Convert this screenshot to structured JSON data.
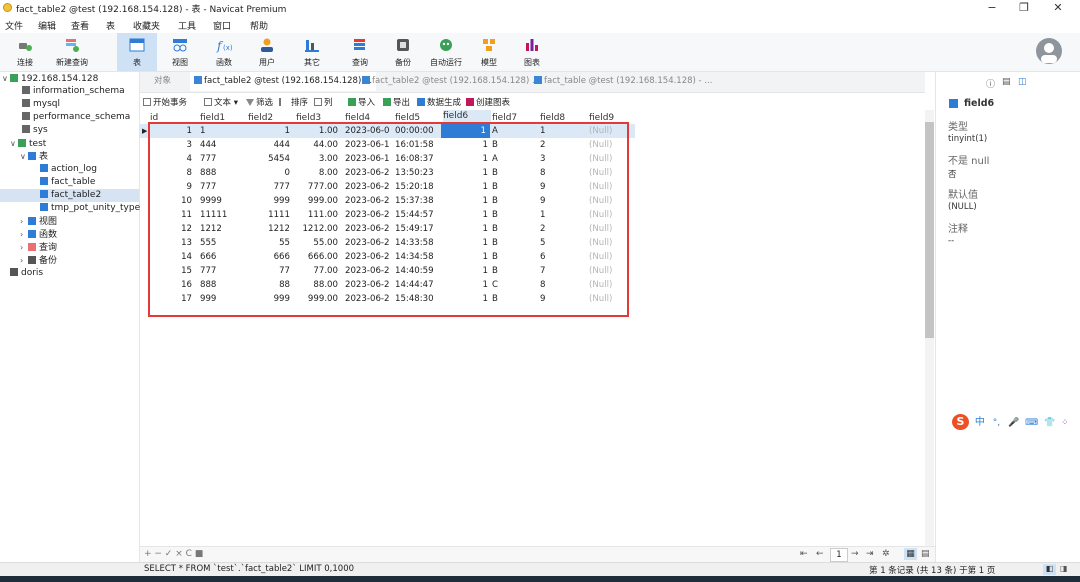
{
  "window": {
    "title": "fact_table2 @test (192.168.154.128) - 表 - Navicat Premium"
  },
  "menu": [
    "文件",
    "编辑",
    "查看",
    "表",
    "收藏夹",
    "工具",
    "窗口",
    "帮助"
  ],
  "toolbar": [
    {
      "label": "连接",
      "icon": "plug-icon",
      "color": "#4caf50"
    },
    {
      "label": "新建查询",
      "icon": "new-query-icon",
      "color": "#4caf50"
    },
    {
      "label": "表",
      "icon": "table-icon",
      "color": "#2e7cd6"
    },
    {
      "label": "视图",
      "icon": "view-icon",
      "color": "#2e7cd6"
    },
    {
      "label": "函数",
      "icon": "function-icon",
      "color": "#2e7cd6"
    },
    {
      "label": "用户",
      "icon": "user-icon",
      "color": "#f0a020"
    },
    {
      "label": "其它",
      "icon": "tools-icon",
      "color": "#2e7cd6"
    },
    {
      "label": "查询",
      "icon": "query-icon",
      "color": "#e53935"
    },
    {
      "label": "备份",
      "icon": "backup-icon",
      "color": "#555"
    },
    {
      "label": "自动运行",
      "icon": "robot-icon",
      "color": "#3aa057"
    },
    {
      "label": "模型",
      "icon": "model-icon",
      "color": "#f0a020"
    },
    {
      "label": "图表",
      "icon": "chart-icon",
      "color": "#c2185b"
    }
  ],
  "tree": {
    "server": "192.168.154.128",
    "databases": [
      "information_schema",
      "mysql",
      "performance_schema",
      "sys"
    ],
    "active_db": "test",
    "tables_label": "表",
    "tables": [
      "action_log",
      "fact_table",
      "fact_table2",
      "tmp_pot_unity_type"
    ],
    "groups": [
      "视图",
      "函数",
      "查询",
      "备份"
    ],
    "other_server": "doris"
  },
  "tabs": {
    "objects": "对象",
    "items": [
      "fact_table2 @test (192.168.154.128) ...",
      "fact_table2 @test (192.168.154.128) ...",
      "fact_table @test (192.168.154.128) - ..."
    ]
  },
  "subtoolbar": [
    "开始事务",
    "文本 ▾",
    "筛选",
    "排序",
    "列",
    "导入",
    "导出",
    "数据生成",
    "创建图表"
  ],
  "grid": {
    "columns": [
      "id",
      "field1",
      "field2",
      "field3",
      "field4",
      "field5",
      "field6",
      "field7",
      "field8",
      "field9"
    ],
    "rows": [
      [
        "1",
        "1",
        "1",
        "1.00",
        "2023-06-0",
        "00:00:00",
        "1",
        "A",
        "1",
        "(Null)"
      ],
      [
        "3",
        "444",
        "444",
        "44.00",
        "2023-06-1",
        "16:01:58",
        "1",
        "B",
        "2",
        "(Null)"
      ],
      [
        "4",
        "777",
        "5454",
        "3.00",
        "2023-06-1",
        "16:08:37",
        "1",
        "A",
        "3",
        "(Null)"
      ],
      [
        "8",
        "888",
        "0",
        "8.00",
        "2023-06-2",
        "13:50:23",
        "1",
        "B",
        "8",
        "(Null)"
      ],
      [
        "9",
        "777",
        "777",
        "777.00",
        "2023-06-2",
        "15:20:18",
        "1",
        "B",
        "9",
        "(Null)"
      ],
      [
        "10",
        "9999",
        "999",
        "999.00",
        "2023-06-2",
        "15:37:38",
        "1",
        "B",
        "9",
        "(Null)"
      ],
      [
        "11",
        "11111",
        "1111",
        "111.00",
        "2023-06-2",
        "15:44:57",
        "1",
        "B",
        "1",
        "(Null)"
      ],
      [
        "12",
        "1212",
        "1212",
        "1212.00",
        "2023-06-2",
        "15:49:17",
        "1",
        "B",
        "2",
        "(Null)"
      ],
      [
        "13",
        "555",
        "55",
        "55.00",
        "2023-06-2",
        "14:33:58",
        "1",
        "B",
        "5",
        "(Null)"
      ],
      [
        "14",
        "666",
        "666",
        "666.00",
        "2023-06-2",
        "14:34:58",
        "1",
        "B",
        "6",
        "(Null)"
      ],
      [
        "15",
        "777",
        "77",
        "77.00",
        "2023-06-2",
        "14:40:59",
        "1",
        "B",
        "7",
        "(Null)"
      ],
      [
        "16",
        "888",
        "88",
        "88.00",
        "2023-06-2",
        "14:44:47",
        "1",
        "C",
        "8",
        "(Null)"
      ],
      [
        "17",
        "999",
        "999",
        "999.00",
        "2023-06-2",
        "15:48:30",
        "1",
        "B",
        "9",
        "(Null)"
      ]
    ]
  },
  "panel": {
    "field": "field6",
    "type_label": "类型",
    "type_value": "tinyint(1)",
    "notnull_label": "不是 null",
    "notnull_value": "否",
    "default_label": "默认值",
    "default_value": "(NULL)",
    "comment_label": "注释",
    "comment_value": "--"
  },
  "nav": {
    "controls": "+ − ✓ × C ■",
    "page": "1"
  },
  "status": {
    "sql": "SELECT * FROM `test`.`fact_table2` LIMIT 0,1000",
    "records": "第 1 条记录 (共 13 条) 于第 1 页"
  },
  "ime": {
    "logo": "S",
    "items": [
      "中",
      "°,",
      "🎤",
      "⌨",
      "👕",
      "⁘"
    ]
  },
  "colors": {
    "accent": "#2e7cd6",
    "highlight": "#e53935",
    "selection": "#dbe8f6"
  }
}
